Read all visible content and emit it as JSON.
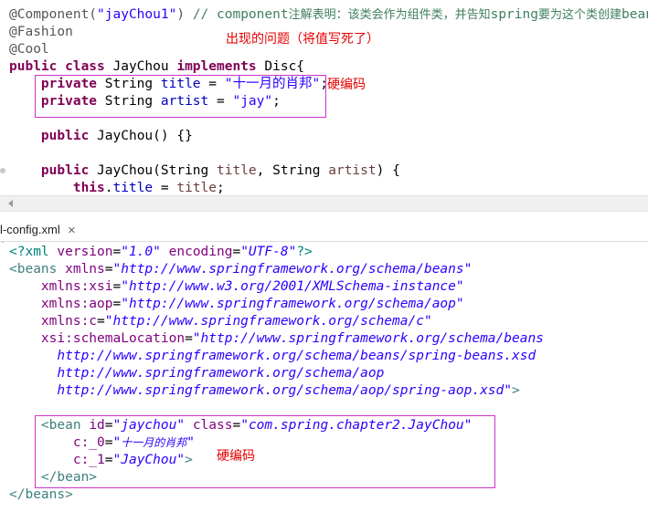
{
  "java": {
    "lines": [
      {
        "parts": [
          [
            "ann",
            "@Component("
          ],
          [
            "str",
            "\"jayChou1\""
          ],
          [
            "ann",
            ")"
          ],
          [
            "plain",
            " "
          ],
          [
            "cmt",
            "// component"
          ],
          [
            "cmtzh",
            "注解表明：该类会作为组件类，并告知"
          ],
          [
            "cmt",
            "spring"
          ],
          [
            "cmtzh",
            "要为这个类创建"
          ],
          [
            "cmt",
            "bean."
          ]
        ]
      },
      {
        "parts": [
          [
            "ann",
            "@Fashion"
          ]
        ]
      },
      {
        "parts": [
          [
            "ann",
            "@Cool"
          ]
        ]
      },
      {
        "parts": [
          [
            "kw",
            "public class"
          ],
          [
            "plain",
            " JayChou "
          ],
          [
            "kw",
            "implements"
          ],
          [
            "plain",
            " Disc{"
          ]
        ]
      },
      {
        "parts": [
          [
            "plain",
            "    "
          ],
          [
            "kw",
            "private"
          ],
          [
            "plain",
            " String "
          ],
          [
            "fld",
            "title"
          ],
          [
            "plain",
            " = "
          ],
          [
            "str",
            "\"十一月的肖邦\""
          ],
          [
            "plain",
            ";"
          ]
        ]
      },
      {
        "parts": [
          [
            "plain",
            "    "
          ],
          [
            "kw",
            "private"
          ],
          [
            "plain",
            " String "
          ],
          [
            "fld",
            "artist"
          ],
          [
            "plain",
            " = "
          ],
          [
            "str",
            "\"jay\""
          ],
          [
            "plain",
            ";"
          ]
        ]
      },
      {
        "parts": []
      },
      {
        "parts": [
          [
            "plain",
            "    "
          ],
          [
            "kw",
            "public"
          ],
          [
            "plain",
            " JayChou() {}"
          ]
        ]
      },
      {
        "parts": []
      },
      {
        "parts": [
          [
            "plain",
            "    "
          ],
          [
            "kw",
            "public"
          ],
          [
            "plain",
            " JayChou(String "
          ],
          [
            "par",
            "title"
          ],
          [
            "plain",
            ", String "
          ],
          [
            "par",
            "artist"
          ],
          [
            "plain",
            ") {"
          ]
        ]
      },
      {
        "parts": [
          [
            "plain",
            "        "
          ],
          [
            "kw",
            "this"
          ],
          [
            "plain",
            "."
          ],
          [
            "fld",
            "title"
          ],
          [
            "plain",
            " = "
          ],
          [
            "par",
            "title"
          ],
          [
            "plain",
            ";"
          ]
        ]
      }
    ],
    "note_problem": "出现的问题（将值写死了）",
    "note_hardcode": "硬编码"
  },
  "tab": {
    "label": "l-config.xml",
    "close_icon": "✕"
  },
  "xml": {
    "lines": [
      {
        "parts": [
          [
            "xpi",
            "<?xml "
          ],
          [
            "xattr",
            "version"
          ],
          [
            "plain",
            "="
          ],
          [
            "xval",
            "\"1.0\""
          ],
          [
            "plain",
            " "
          ],
          [
            "xattr",
            "encoding"
          ],
          [
            "plain",
            "="
          ],
          [
            "xval",
            "\"UTF-8\""
          ],
          [
            "xpi",
            "?>"
          ]
        ]
      },
      {
        "parts": [
          [
            "xtag",
            "<beans "
          ],
          [
            "xattr",
            "xmlns"
          ],
          [
            "plain",
            "="
          ],
          [
            "xval",
            "\"http://www.springframework.org/schema/beans\""
          ]
        ]
      },
      {
        "parts": [
          [
            "plain",
            "    "
          ],
          [
            "xattr",
            "xmlns:xsi"
          ],
          [
            "plain",
            "="
          ],
          [
            "xval",
            "\"http://www.w3.org/2001/XMLSchema-instance\""
          ]
        ]
      },
      {
        "parts": [
          [
            "plain",
            "    "
          ],
          [
            "xattr",
            "xmlns:aop"
          ],
          [
            "plain",
            "="
          ],
          [
            "xval",
            "\"http://www.springframework.org/schema/aop\""
          ]
        ]
      },
      {
        "parts": [
          [
            "plain",
            "    "
          ],
          [
            "xattr",
            "xmlns:c"
          ],
          [
            "plain",
            "="
          ],
          [
            "xval",
            "\"http://www.springframework.org/schema/c\""
          ]
        ]
      },
      {
        "parts": [
          [
            "plain",
            "    "
          ],
          [
            "xattr",
            "xsi:schemaLocation"
          ],
          [
            "plain",
            "="
          ],
          [
            "xval",
            "\"http://www.springframework.org/schema/beans"
          ]
        ]
      },
      {
        "parts": [
          [
            "plain",
            "      "
          ],
          [
            "xval",
            "http://www.springframework.org/schema/beans/spring-beans.xsd"
          ]
        ]
      },
      {
        "parts": [
          [
            "plain",
            "      "
          ],
          [
            "xval",
            "http://www.springframework.org/schema/aop"
          ]
        ]
      },
      {
        "parts": [
          [
            "plain",
            "      "
          ],
          [
            "xval",
            "http://www.springframework.org/schema/aop/spring-aop.xsd\""
          ],
          [
            "xtag",
            ">"
          ]
        ]
      },
      {
        "parts": []
      },
      {
        "parts": [
          [
            "plain",
            "    "
          ],
          [
            "xtag",
            "<bean "
          ],
          [
            "xattr",
            "id"
          ],
          [
            "plain",
            "="
          ],
          [
            "xval",
            "\"jaychou\""
          ],
          [
            "plain",
            " "
          ],
          [
            "xattr",
            "class"
          ],
          [
            "plain",
            "="
          ],
          [
            "xval",
            "\"com.spring.chapter2.JayChou\""
          ]
        ]
      },
      {
        "parts": [
          [
            "plain",
            "        "
          ],
          [
            "xattr",
            "c:_0"
          ],
          [
            "plain",
            "="
          ],
          [
            "xval",
            "\""
          ],
          [
            "xvalzh",
            "十一月的肖邦"
          ],
          [
            "xval",
            "\""
          ]
        ]
      },
      {
        "parts": [
          [
            "plain",
            "        "
          ],
          [
            "xattr",
            "c:_1"
          ],
          [
            "plain",
            "="
          ],
          [
            "xval",
            "\"JayChou\""
          ],
          [
            "xtag",
            ">"
          ]
        ]
      },
      {
        "parts": [
          [
            "plain",
            "    "
          ],
          [
            "xtag",
            "</bean>"
          ]
        ]
      },
      {
        "parts": [
          [
            "xtag",
            "</beans>"
          ]
        ]
      }
    ],
    "note_hardcode": "硬编码"
  }
}
